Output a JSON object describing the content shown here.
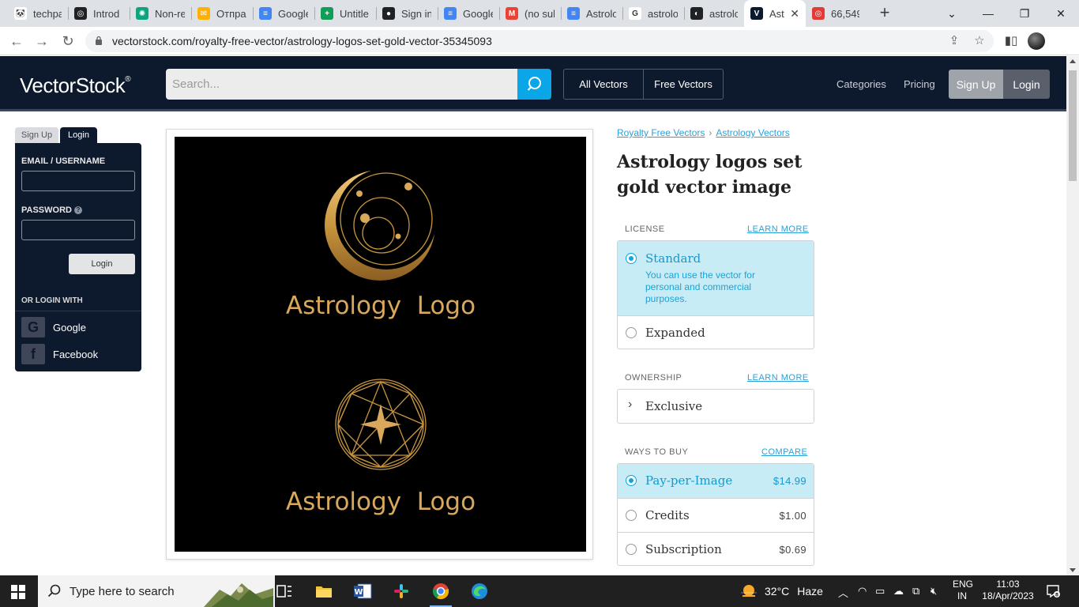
{
  "browser": {
    "tabs": [
      {
        "title": "techpa",
        "color": "#ffffff",
        "glyph": "🐼"
      },
      {
        "title": "Introd",
        "color": "#202124",
        "glyph": "◎"
      },
      {
        "title": "Non-re",
        "color": "#10a37f",
        "glyph": "✺"
      },
      {
        "title": "Отправ",
        "color": "#ffb000",
        "glyph": "✉"
      },
      {
        "title": "Google",
        "color": "#4285f4",
        "glyph": "≡"
      },
      {
        "title": "Untitle",
        "color": "#0f9d58",
        "glyph": "+"
      },
      {
        "title": "Sign in",
        "color": "#202124",
        "glyph": "●"
      },
      {
        "title": "Google",
        "color": "#4285f4",
        "glyph": "≡"
      },
      {
        "title": "(no sub",
        "color": "#ea4335",
        "glyph": "M"
      },
      {
        "title": "Astrolo",
        "color": "#4285f4",
        "glyph": "≡"
      },
      {
        "title": "astrolo",
        "color": "#ffffff",
        "glyph": "G"
      },
      {
        "title": "astrolo",
        "color": "#202124",
        "glyph": "◐"
      },
      {
        "title": "Ast",
        "color": "#0d1a2e",
        "glyph": "V",
        "active": true
      },
      {
        "title": "66,549",
        "color": "#e53935",
        "glyph": "◎"
      }
    ],
    "url": "vectorstock.com/royalty-free-vector/astrology-logos-set-gold-vector-35345093"
  },
  "site": {
    "logo_main": "VectorStock",
    "logo_mark": "®",
    "search_placeholder": "Search...",
    "filter_all": "All Vectors",
    "filter_free": "Free Vectors",
    "nav_categories": "Categories",
    "nav_pricing": "Pricing",
    "signup": "Sign Up",
    "login": "Login"
  },
  "login_panel": {
    "tab_signup": "Sign Up",
    "tab_login": "Login",
    "email_label": "EMAIL / USERNAME",
    "password_label": "PASSWORD",
    "help_glyph": "?",
    "login_button": "Login",
    "or_login_with": "OR LOGIN WITH",
    "google": "Google",
    "facebook": "Facebook"
  },
  "product": {
    "image_text_1": "Astrology  Logo",
    "image_text_2": "Astrology  Logo",
    "breadcrumb_1": "Royalty Free Vectors",
    "breadcrumb_sep": "›",
    "breadcrumb_2": "Astrology Vectors",
    "title": "Astrology logos set gold vector image",
    "license_label": "LICENSE",
    "license_link": "LEARN MORE",
    "standard": "Standard",
    "standard_desc": "You can use the vector for personal and commercial purposes.",
    "expanded": "Expanded",
    "ownership_label": "OWNERSHIP",
    "ownership_link": "LEARN MORE",
    "exclusive": "Exclusive",
    "ways_label": "WAYS TO BUY",
    "ways_link": "COMPARE",
    "ppi": "Pay-per-Image",
    "ppi_price": "$14.99",
    "credits": "Credits",
    "credits_price": "$1.00",
    "subscription": "Subscription",
    "subscription_price": "$0.69"
  },
  "taskbar": {
    "search_placeholder": "Type here to search",
    "temperature": "32°C",
    "weather": "Haze",
    "lang_1": "ENG",
    "lang_2": "IN",
    "time": "11:03",
    "date": "18/Apr/2023",
    "notif_count": "8"
  },
  "colors": {
    "header_bg": "#0d1a2e",
    "accent": "#0aa6e8",
    "gold": "#c8963e"
  }
}
